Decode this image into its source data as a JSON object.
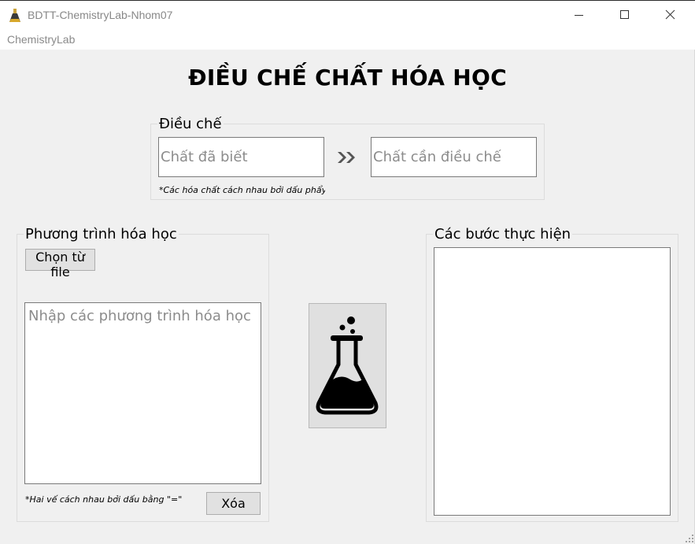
{
  "window": {
    "title": "BDTT-ChemistryLab-Nhom07",
    "icon": "flask-app-icon"
  },
  "menu": {
    "items": [
      "ChemistryLab"
    ]
  },
  "main_title": "ĐIỀU CHẾ CHẤT HÓA HỌC",
  "dieu_che": {
    "legend": "Điều chế",
    "known_placeholder": "Chất đã biết",
    "known_value": "",
    "target_placeholder": "Chất cần điều chế",
    "target_value": "",
    "note": "*Các hóa chất cách nhau bởi dấu phẩy",
    "arrow_icon": "double-chevron-right-icon"
  },
  "phuong_trinh": {
    "legend": "Phương trình hóa học",
    "choose_file_label": "Chọn từ file",
    "equations_placeholder": "Nhập các phương trình hóa học",
    "equations_value": "",
    "note": "*Hai vế cách nhau bởi dấu bằng \"=\"",
    "clear_label": "Xóa"
  },
  "run_button": {
    "icon": "chemistry-flask-icon"
  },
  "cac_buoc": {
    "legend": "Các bước thực hiện",
    "steps_value": ""
  },
  "colors": {
    "window_bg": "#f0f0f0",
    "input_bg": "#ffffff",
    "button_bg": "#e1e1e1",
    "placeholder": "#8c8c8c"
  }
}
